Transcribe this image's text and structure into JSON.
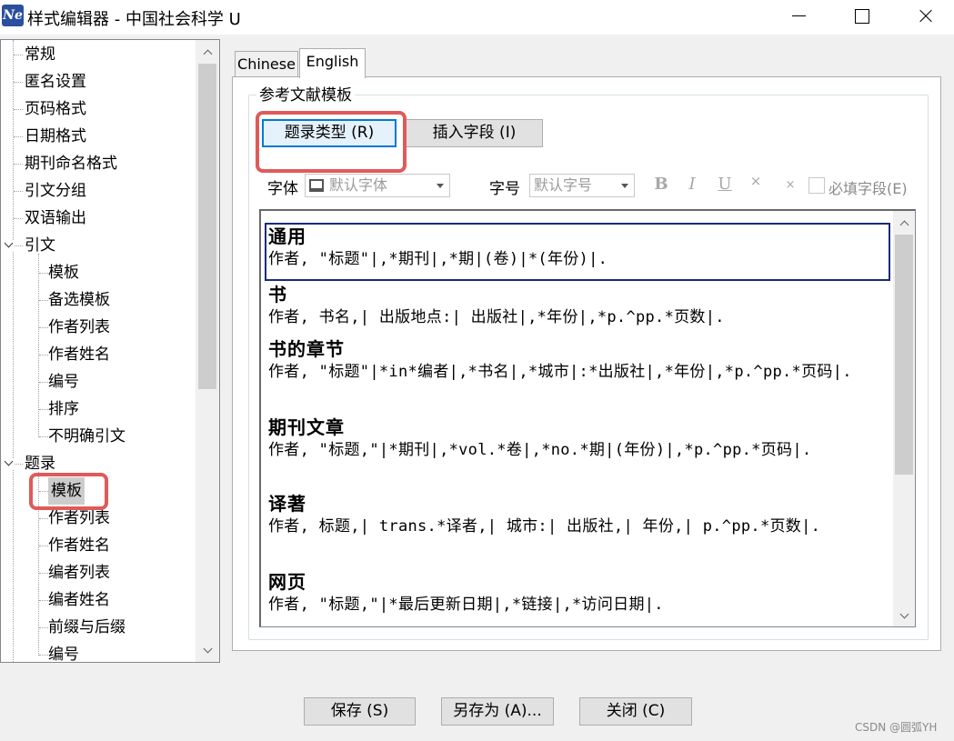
{
  "window": {
    "icon_text": "Ne",
    "title": "样式编辑器 - 中国社会科学 U"
  },
  "tree": {
    "items": [
      {
        "label": "常规",
        "level": 0
      },
      {
        "label": "匿名设置",
        "level": 0
      },
      {
        "label": "页码格式",
        "level": 0
      },
      {
        "label": "日期格式",
        "level": 0
      },
      {
        "label": "期刊命名格式",
        "level": 0
      },
      {
        "label": "引文分组",
        "level": 0
      },
      {
        "label": "双语输出",
        "level": 0
      },
      {
        "label": "引文",
        "level": 0,
        "expanded": true
      },
      {
        "label": "模板",
        "level": 1
      },
      {
        "label": "备选模板",
        "level": 1
      },
      {
        "label": "作者列表",
        "level": 1
      },
      {
        "label": "作者姓名",
        "level": 1
      },
      {
        "label": "编号",
        "level": 1
      },
      {
        "label": "排序",
        "level": 1
      },
      {
        "label": "不明确引文",
        "level": 1
      },
      {
        "label": "题录",
        "level": 0,
        "expanded": true
      },
      {
        "label": "模板",
        "level": 1,
        "selected": true
      },
      {
        "label": "作者列表",
        "level": 1
      },
      {
        "label": "作者姓名",
        "level": 1
      },
      {
        "label": "编者列表",
        "level": 1
      },
      {
        "label": "编者姓名",
        "level": 1
      },
      {
        "label": "前缀与后缀",
        "level": 1
      },
      {
        "label": "编号",
        "level": 1
      }
    ]
  },
  "tabs": [
    {
      "label": "Chinese",
      "active": false
    },
    {
      "label": "English",
      "active": true
    }
  ],
  "group": {
    "title": "参考文献模板",
    "ref_type_button": "题录类型 (R)",
    "insert_field_button": "插入字段 (I)"
  },
  "format_bar": {
    "font_label": "字体",
    "font_value": "默认字体",
    "size_label": "字号",
    "size_value": "默认字号",
    "bold": "B",
    "italic": "I",
    "underline": "U",
    "superscript": "×",
    "subscript": "×",
    "required_label": "必填字段(E)"
  },
  "templates": [
    {
      "name": "通用",
      "body": "作者, \"标题\"|,*期刊|,*期|(卷)|*(年份)|."
    },
    {
      "name": "书",
      "body": "作者, 书名,| 出版地点:| 出版社|,*年份|,*p.^pp.*页数|."
    },
    {
      "name": "书的章节",
      "body": "作者, \"标题\"|*in*编者|,*书名|,*城市|:*出版社|,*年份|,*p.^pp.*页码|."
    },
    {
      "name": "期刊文章",
      "body": "作者, \"标题,\"|*期刊|,*vol.*卷|,*no.*期|(年份)|,*p.^pp.*页码|."
    },
    {
      "name": "译著",
      "body": "作者, 标题,| trans.*译者,| 城市:| 出版社,| 年份,| p.^pp.*页数|."
    },
    {
      "name": "网页",
      "body": "作者, \"标题,\"|*最后更新日期|,*链接|,*访问日期|."
    }
  ],
  "footer": {
    "save": "保存 (S)",
    "save_as": "另存为 (A)...",
    "close": "关闭 (C)"
  },
  "watermark": "CSDN @圆弧YH",
  "colors": {
    "highlight_red": "#e05a5a",
    "selection_border": "#1a2a7a",
    "focus_blue": "#0078d7"
  }
}
